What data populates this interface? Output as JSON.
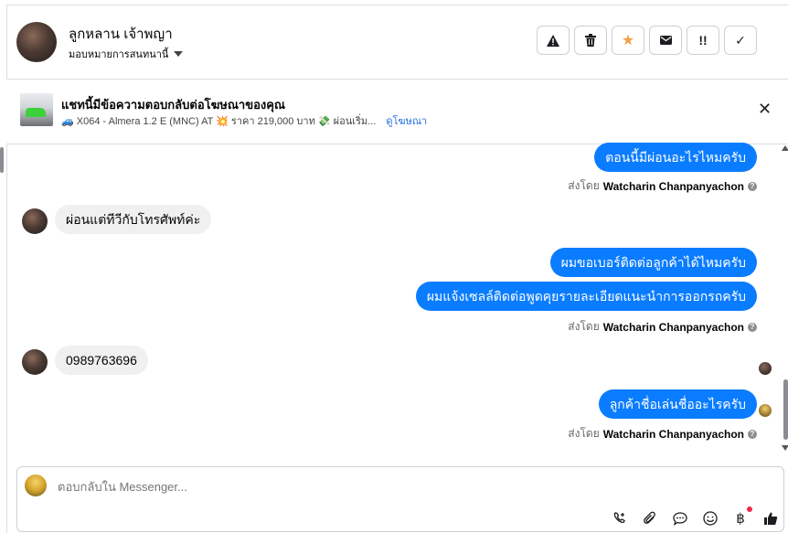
{
  "header": {
    "contact_name": "ลูกหลาน เจ้าพญา",
    "assign_label": "มอบหมายการสนทนานี้",
    "tools": [
      {
        "icon": "warning-icon",
        "glyph": "⚠"
      },
      {
        "icon": "trash-icon",
        "glyph": "🗑"
      },
      {
        "icon": "star-icon",
        "glyph": "★"
      },
      {
        "icon": "mail-icon",
        "glyph": "✉"
      },
      {
        "icon": "important-icon",
        "glyph": "!!"
      },
      {
        "icon": "check-icon",
        "glyph": "✓"
      }
    ]
  },
  "ad": {
    "title": "แชทนี้มีข้อความตอบกลับต่อโฆษณาของคุณ",
    "details": "🚙 X064 - Almera 1.2 E (MNC) AT 💥 ราคา 219,000 บาท 💸 ผ่อนเริ่ม...",
    "link": "ดูโฆษณา",
    "close": "✕"
  },
  "messages": {
    "m1": "ตอนนี้มีผ่อนอะไรไหมครับ",
    "sent_prefix": "ส่งโดย",
    "sender": "Watcharin Chanpanyachon",
    "m2": "ผ่อนแต่ทีวีกับโทรศัพท์ค่ะ",
    "m3": "ผมขอเบอร์ติดต่อลูกค้าได้ไหมครับ",
    "m4": "ผมแจ้งเซลล์ติดต่อพูดคุยรายละเอียดแนะนำการออกรถครับ",
    "m5": "0989763696",
    "m6": "ลูกค้าชื่อเล่นชื่ออะไรครับ"
  },
  "composer": {
    "placeholder": "ตอบกลับใน Messenger...",
    "icons": [
      "call-add-icon",
      "attachment-icon",
      "chat-bubble-icon",
      "emoji-icon",
      "baht-icon",
      "thumbs-up-icon"
    ]
  },
  "colors": {
    "accent": "#0a7cff",
    "star": "#f0a04b",
    "link": "#216fdb"
  }
}
